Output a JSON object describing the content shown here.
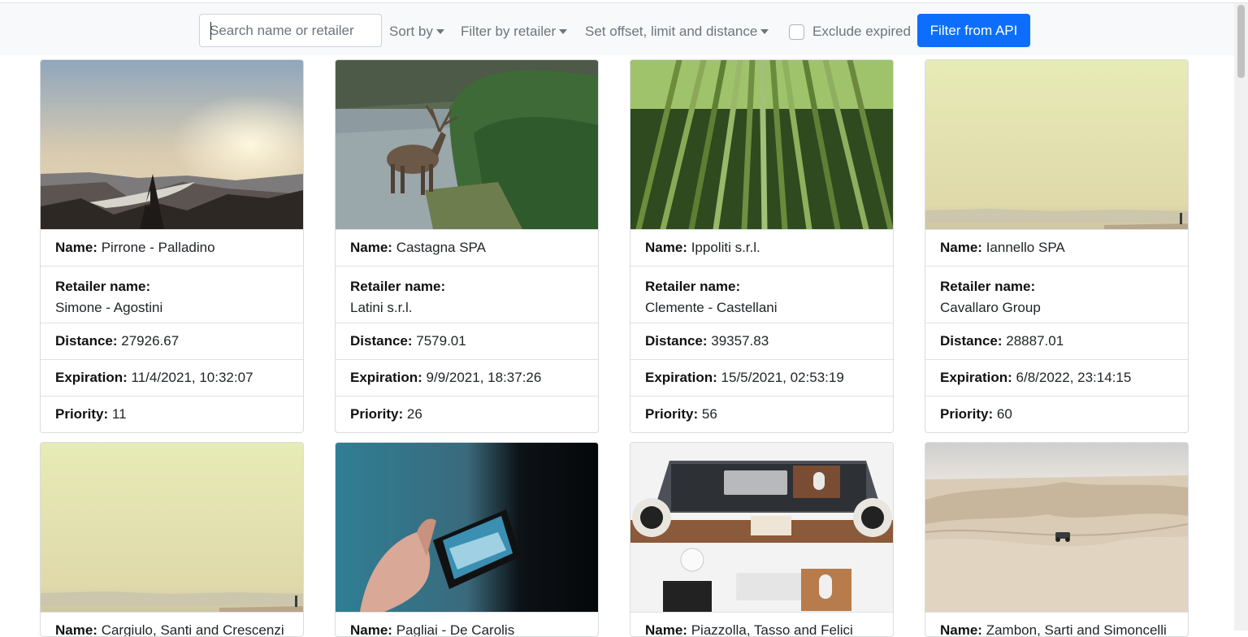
{
  "toolbar": {
    "search_placeholder": "Search name or retailer",
    "sort_label": "Sort by",
    "retailer_filter_label": "Filter by retailer",
    "offset_label": "Set offset, limit and distance",
    "exclude_expired_label": "Exclude expired",
    "api_button_label": "Filter from API"
  },
  "labels": {
    "name": "Name:",
    "retailer": "Retailer name:",
    "distance": "Distance:",
    "expiration": "Expiration:",
    "priority": "Priority:"
  },
  "cards": [
    {
      "image": "mountain-sunset",
      "name": "Pirrone - Palladino",
      "retailer": "Simone - Agostini",
      "distance": "27926.67",
      "expiration": "11/4/2021, 10:32:07",
      "priority": "11"
    },
    {
      "image": "deer-river",
      "name": "Castagna SPA",
      "retailer": "Latini s.r.l.",
      "distance": "7579.01",
      "expiration": "9/9/2021, 18:37:26",
      "priority": "26"
    },
    {
      "image": "bamboo-forest",
      "name": "Ippoliti s.r.l.",
      "retailer": "Clemente - Castellani",
      "distance": "39357.83",
      "expiration": "15/5/2021, 02:53:19",
      "priority": "56"
    },
    {
      "image": "hazy-horizon",
      "name": "Iannello SPA",
      "retailer": "Cavallaro Group",
      "distance": "28887.01",
      "expiration": "6/8/2022, 23:14:15",
      "priority": "60"
    },
    {
      "image": "hazy-horizon",
      "name": "Cargiulo, Santi and Crescenzi"
    },
    {
      "image": "phone-photo",
      "name": "Pagliai - De Carolis"
    },
    {
      "image": "desk-setup",
      "name": "Piazzolla, Tasso and Felici"
    },
    {
      "image": "desert-dunes",
      "name": "Zambon, Sarti and Simoncelli"
    }
  ]
}
